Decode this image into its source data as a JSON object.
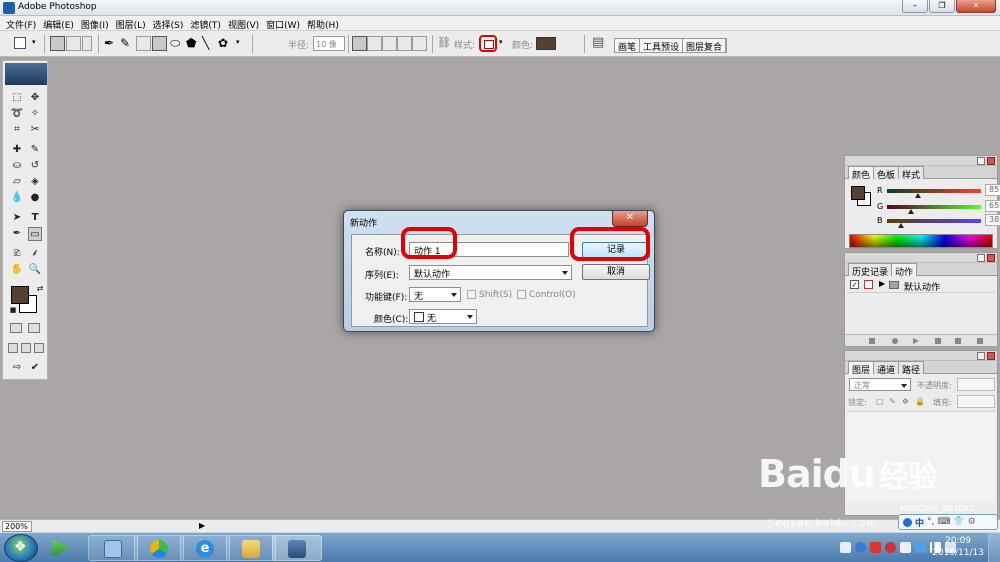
{
  "window": {
    "title": "Adobe Photoshop",
    "buttons": [
      "–",
      "❐",
      "✕"
    ]
  },
  "menu": [
    "文件(F)",
    "编辑(E)",
    "图像(I)",
    "图层(L)",
    "选择(S)",
    "滤镜(T)",
    "视图(V)",
    "窗口(W)",
    "帮助(H)"
  ],
  "options_bar": {
    "radius_label": "半径:",
    "radius_value": "10 像",
    "style_label": "样式:",
    "color_label": "颜色:",
    "color_value": "#554130",
    "dock_tabs": [
      "画笔",
      "工具预设",
      "图层复合"
    ]
  },
  "toolbox": {
    "foreground": "#554130",
    "background": "#ffffff"
  },
  "dialog": {
    "title": "新动作",
    "name_label": "名称(N):",
    "name_value": "动作 1",
    "set_label": "序列(E):",
    "set_value": "默认动作",
    "fkey_label": "功能键(F):",
    "fkey_value": "无",
    "shift_label": "Shift(S)",
    "control_label": "Control(O)",
    "color_label": "颜色(C):",
    "color_value": "无",
    "record_button": "记录",
    "cancel_button": "取消",
    "highlight_color": "#e40000"
  },
  "color_panel": {
    "tabs": [
      "颜色",
      "色板",
      "样式"
    ],
    "channels": [
      {
        "label": "R",
        "value": "85",
        "fraction": 0.333
      },
      {
        "label": "G",
        "value": "65",
        "fraction": 0.255
      },
      {
        "label": "B",
        "value": "38",
        "fraction": 0.149
      }
    ],
    "swatch": "#554130"
  },
  "history_panel": {
    "tabs": [
      "历史记录",
      "动作"
    ],
    "items": [
      {
        "label": "默认动作"
      }
    ]
  },
  "layers_panel": {
    "tabs": [
      "图层",
      "通道",
      "路径"
    ],
    "blend_mode": "正常",
    "opacity_label": "不透明度:",
    "lock_label": "锁定:",
    "fill_label": "填充:"
  },
  "statusbar": {
    "zoom": "200%"
  },
  "taskbar": {
    "time": "20:09",
    "date": "2016/11/13"
  },
  "ime": {
    "label": "中"
  },
  "watermark": {
    "main": "Baidu",
    "suffix": "经验",
    "url": "jingyan.baidu.com",
    "partial_text": "MERCURY_B87DA2"
  }
}
